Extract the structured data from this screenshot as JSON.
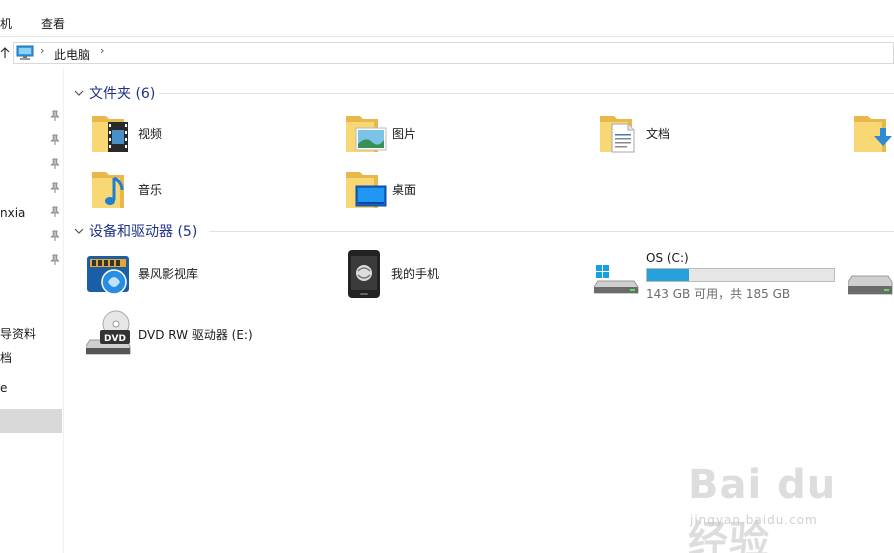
{
  "ribbon": {
    "tabs": [
      "机",
      "查看"
    ]
  },
  "address": {
    "crumb": "此电脑",
    "sep1": "›",
    "sep2": "›"
  },
  "nav": {
    "items": [
      "nxia",
      "导资料",
      "档",
      "e"
    ]
  },
  "folders_group": {
    "title": "文件夹 (6)"
  },
  "folders": [
    {
      "label": "视频",
      "icon": "videos-folder-icon"
    },
    {
      "label": "图片",
      "icon": "pictures-folder-icon"
    },
    {
      "label": "文档",
      "icon": "documents-folder-icon"
    },
    {
      "label": "",
      "icon": "downloads-folder-icon"
    },
    {
      "label": "音乐",
      "icon": "music-folder-icon"
    },
    {
      "label": "桌面",
      "icon": "desktop-folder-icon"
    }
  ],
  "devices_group": {
    "title": "设备和驱动器 (5)"
  },
  "devices": [
    {
      "label": "暴风影视库",
      "icon": "baofeng-library-icon"
    },
    {
      "label": "我的手机",
      "icon": "phone-icon"
    },
    {
      "label": "DVD RW 驱动器 (E:)",
      "icon": "dvd-drive-icon",
      "badge": "DVD"
    }
  ],
  "drive_c": {
    "name": "OS (C:)",
    "free": "143 GB 可用，共 185 GB",
    "used_fraction": 0.227
  },
  "watermark": {
    "big": "Bai du 经验",
    "small": "jingyan.baidu.com"
  },
  "colors": {
    "accent": "#26a0da",
    "group_title": "#1e3287",
    "folder": "#f8d775"
  }
}
